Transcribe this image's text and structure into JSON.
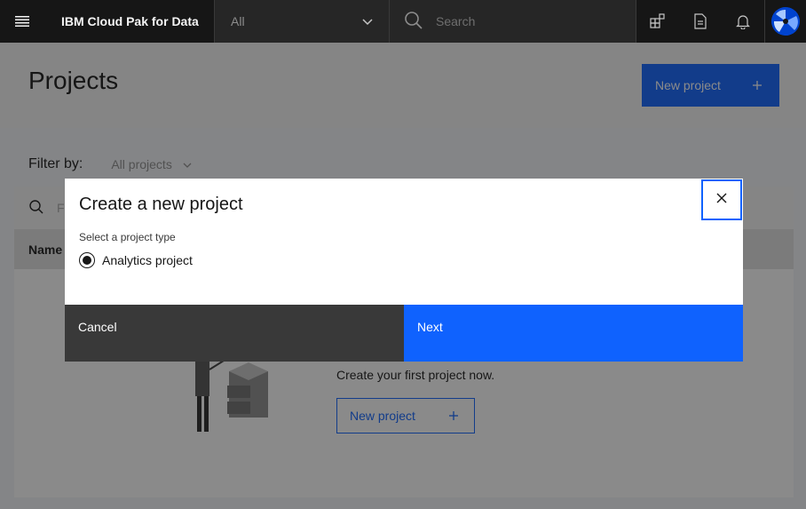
{
  "header": {
    "brand": "IBM Cloud Pak for Data",
    "scope_value": "All",
    "search_placeholder": "Search"
  },
  "page": {
    "title": "Projects",
    "new_project_label": "New project",
    "filter_label": "Filter by:",
    "filter_value": "All projects",
    "table_search_placeholder": "F",
    "table_header_name": "Name",
    "empty_message": "Create your first project now.",
    "empty_new_project_label": "New project"
  },
  "modal": {
    "title": "Create a new project",
    "type_label": "Select a project type",
    "option_label": "Analytics project",
    "cancel_label": "Cancel",
    "next_label": "Next"
  },
  "colors": {
    "primary": "#0f62fe",
    "header_bg": "#161616",
    "secondary_button": "#393939"
  }
}
